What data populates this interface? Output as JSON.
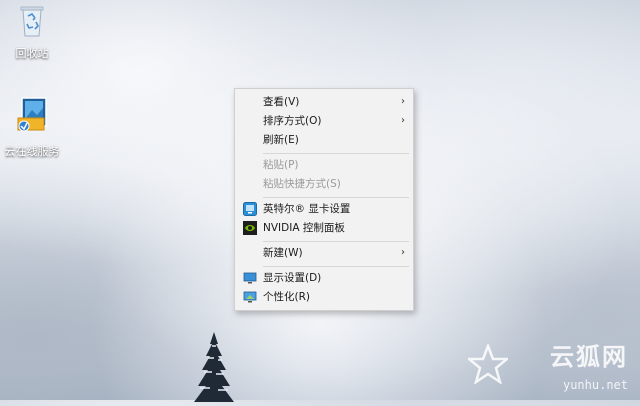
{
  "desktop": {
    "icons": [
      {
        "label": "回收站",
        "icon": "recycle-bin-icon"
      },
      {
        "label": "云在线服务",
        "icon": "cloud-service-icon"
      }
    ]
  },
  "context_menu": {
    "items": [
      {
        "label": "查看(V)",
        "submenu": true,
        "enabled": true
      },
      {
        "label": "排序方式(O)",
        "submenu": true,
        "enabled": true
      },
      {
        "label": "刷新(E)",
        "submenu": false,
        "enabled": true
      },
      {
        "label": "粘贴(P)",
        "submenu": false,
        "enabled": false
      },
      {
        "label": "粘贴快捷方式(S)",
        "submenu": false,
        "enabled": false
      },
      {
        "label": "英特尔® 显卡设置",
        "icon": "intel-graphics-icon",
        "enabled": true
      },
      {
        "label": "NVIDIA 控制面板",
        "icon": "nvidia-icon",
        "enabled": true
      },
      {
        "label": "新建(W)",
        "submenu": true,
        "enabled": true
      },
      {
        "label": "显示设置(D)",
        "icon": "display-settings-icon",
        "enabled": true
      },
      {
        "label": "个性化(R)",
        "icon": "personalize-icon",
        "enabled": true
      }
    ],
    "submenu_arrow": "›"
  },
  "watermark": {
    "title": "云狐网",
    "url": "yunhu.net"
  },
  "colors": {
    "menu_bg": "#f2f2f2",
    "disabled_text": "#9a9a9a",
    "nvidia_green": "#76b900",
    "intel_blue": "#2b8fd6"
  }
}
